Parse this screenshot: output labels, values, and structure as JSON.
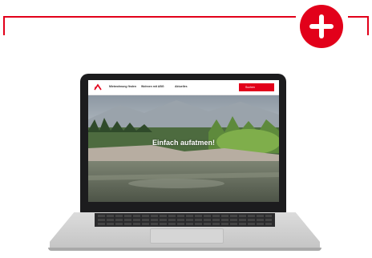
{
  "colors": {
    "accent": "#e2001a"
  },
  "badge": {
    "icon": "plus-icon"
  },
  "site": {
    "logo": "brand-logo-icon",
    "nav": [
      "Mietwohnung finden",
      "Wohnen mit ABG",
      "Aktuelles"
    ],
    "cta_label": "Suchen",
    "hero_title": "Einfach aufatmen!"
  }
}
